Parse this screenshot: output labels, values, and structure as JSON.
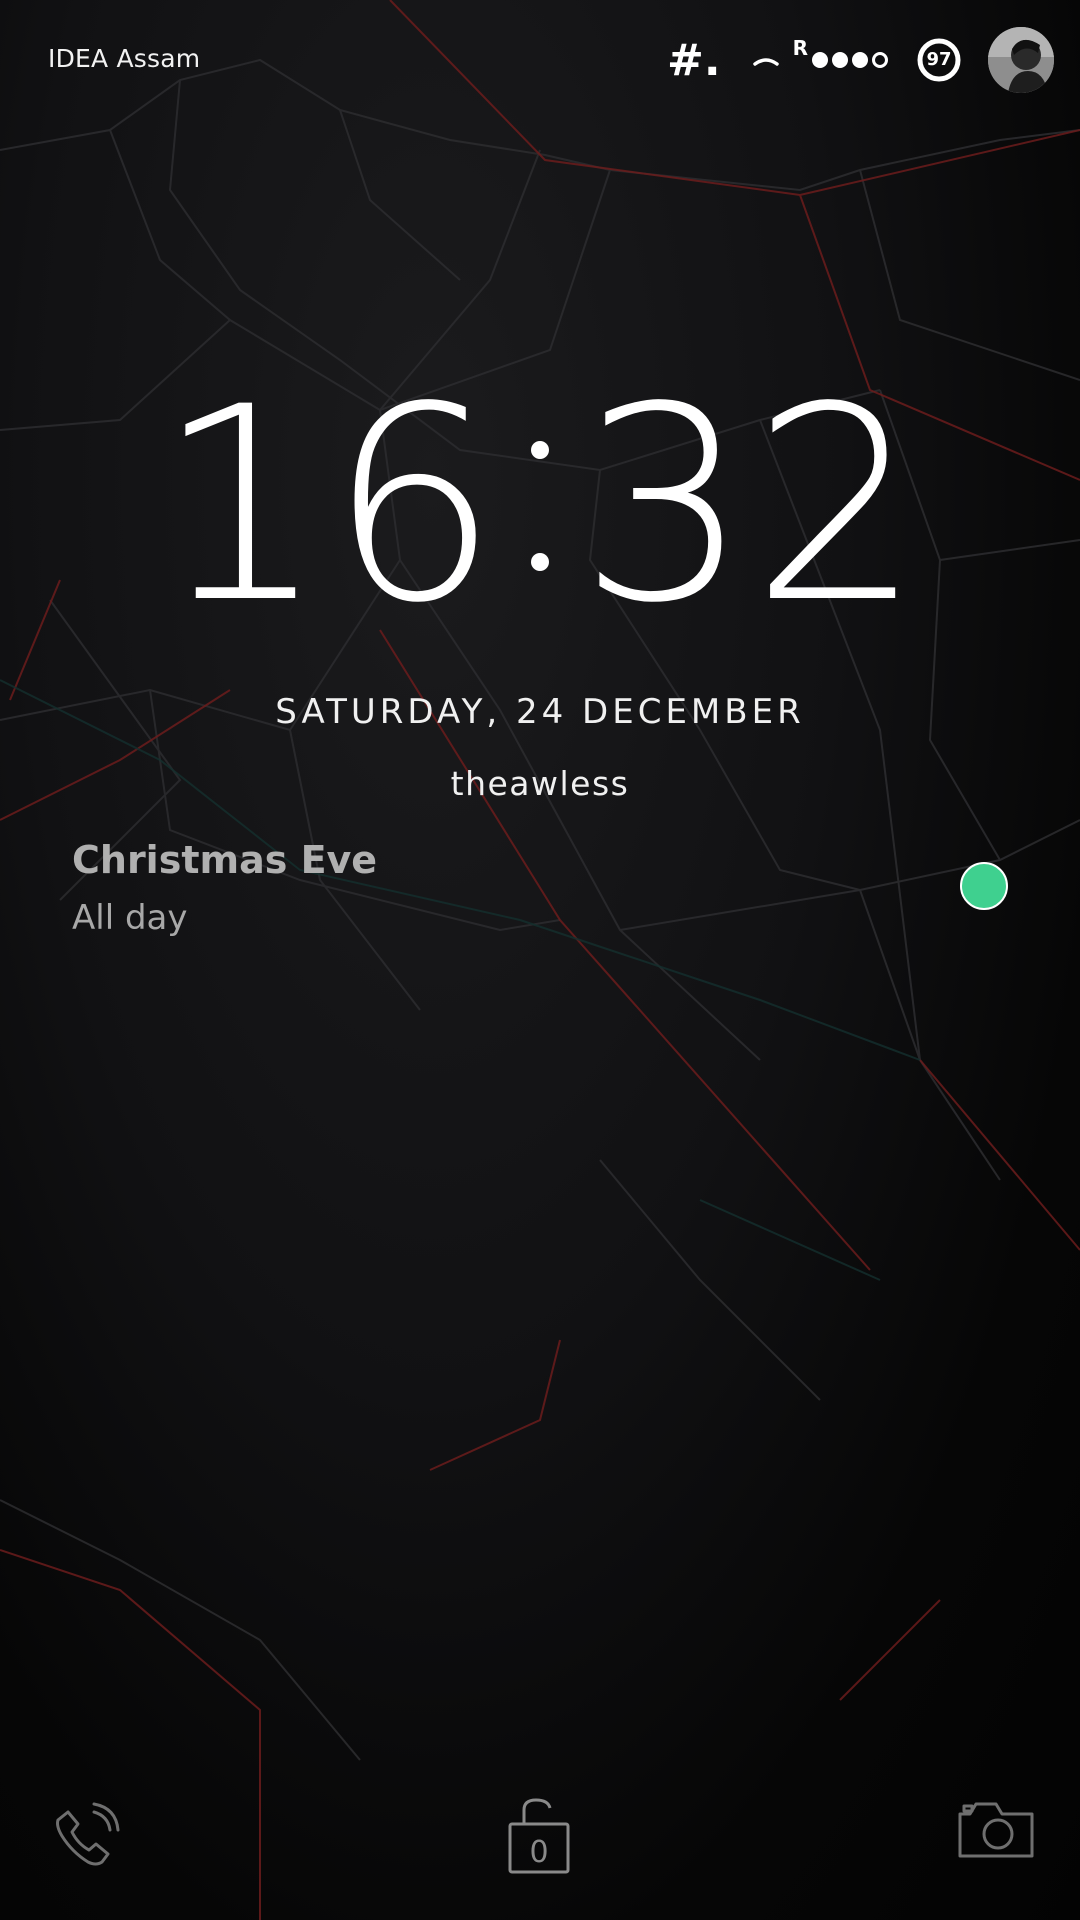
{
  "status_bar": {
    "carrier": "IDEA Assam",
    "hash_icon": "#.",
    "roaming": "R",
    "signal_strength": "3/4",
    "battery_percent": "97",
    "avatar_icon": "user-avatar-icon"
  },
  "lock_screen": {
    "clock_hours": "16",
    "clock_minutes": "32",
    "date": "SATURDAY, 24 DECEMBER",
    "owner": "theawless"
  },
  "event": {
    "title": "Christmas Eve",
    "subtitle": "All day",
    "dot_color": "#3fd08f"
  },
  "bottom": {
    "phone_icon": "phone-icon",
    "unlock_count": "0",
    "camera_icon": "camera-icon"
  }
}
